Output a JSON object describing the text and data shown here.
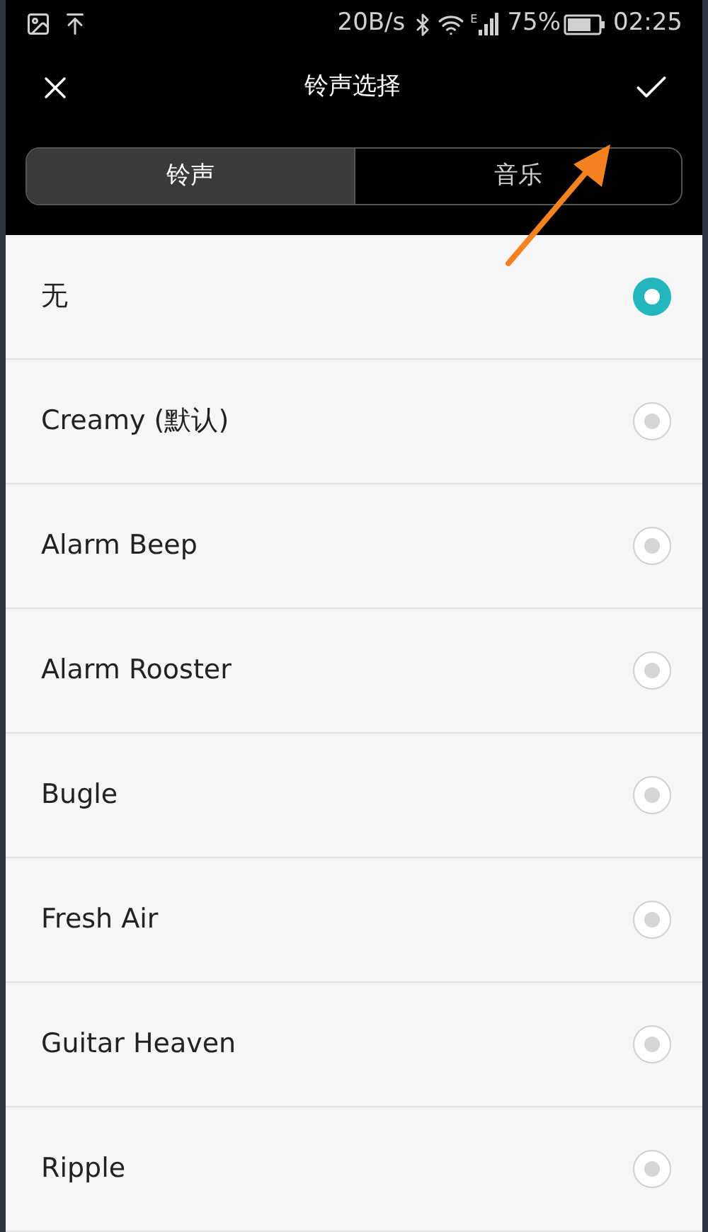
{
  "status_bar": {
    "speed": "20B/s",
    "network": "E",
    "battery": "75%",
    "time": "02:25"
  },
  "header": {
    "title": "铃声选择"
  },
  "tabs": [
    {
      "label": "铃声",
      "selected": true
    },
    {
      "label": "音乐",
      "selected": false
    }
  ],
  "ringtones": [
    {
      "name": "无",
      "selected": true
    },
    {
      "name": "Creamy (默认)",
      "selected": false
    },
    {
      "name": "Alarm Beep",
      "selected": false
    },
    {
      "name": "Alarm Rooster",
      "selected": false
    },
    {
      "name": "Bugle",
      "selected": false
    },
    {
      "name": "Fresh Air",
      "selected": false
    },
    {
      "name": "Guitar Heaven",
      "selected": false
    },
    {
      "name": "Ripple",
      "selected": false
    }
  ]
}
